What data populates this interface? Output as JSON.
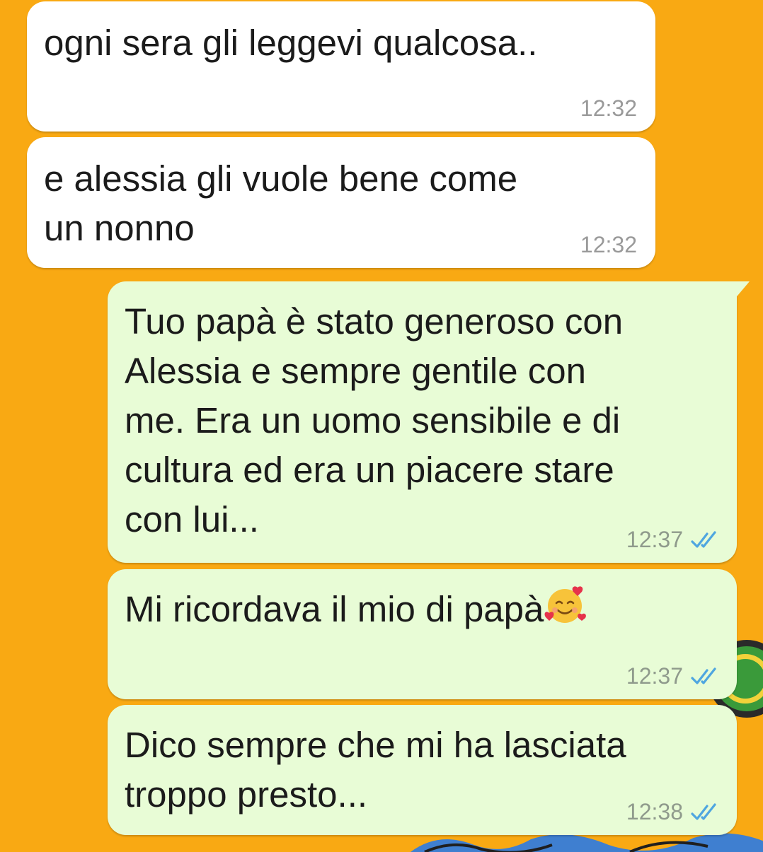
{
  "theme": {
    "wallpaper": "#F9A913",
    "incoming_bubble": "#FFFFFF",
    "outgoing_bubble": "#E8FCD6",
    "read_tick_color": "#4FA6E0"
  },
  "messages": [
    {
      "direction": "incoming",
      "text": "ogni sera gli leggevi qualcosa..",
      "time": "12:32"
    },
    {
      "direction": "incoming",
      "text": "e alessia gli vuole bene come\nun nonno",
      "time": "12:32"
    },
    {
      "direction": "outgoing",
      "text": "Tuo papà è stato generoso con\nAlessia e sempre gentile con\nme. Era un uomo sensibile e di\ncultura ed era un piacere stare\ncon lui...",
      "time": "12:37",
      "status_icon": "double-check-read-icon"
    },
    {
      "direction": "outgoing",
      "text": "Mi ricordava il mio di papà",
      "emoji": "smiling-face-with-hearts-icon",
      "time": "12:37",
      "status_icon": "double-check-read-icon"
    },
    {
      "direction": "outgoing",
      "text": "Dico sempre che mi ha lasciata\ntroppo presto...",
      "time": "12:38",
      "status_icon": "double-check-read-icon"
    }
  ]
}
